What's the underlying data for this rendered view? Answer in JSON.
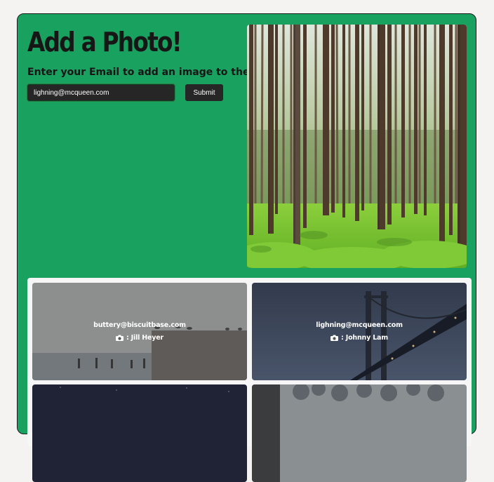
{
  "header": {
    "title": "Add a Photo!",
    "subtitle": "Enter your Email to add an image to the list"
  },
  "form": {
    "email_value": "lighning@mcqueen.com",
    "submit_label": "Submit"
  },
  "gallery": {
    "tiles": [
      {
        "email": "buttery@biscuitbase.com",
        "credit": ": Jill Heyer"
      },
      {
        "email": "lighning@mcqueen.com",
        "credit": ": Johnny Lam"
      },
      {
        "email": "",
        "credit": ""
      },
      {
        "email": "",
        "credit": ""
      }
    ]
  },
  "colors": {
    "background": "#f4f3f2",
    "card": "#19a15f",
    "dark": "#262626"
  },
  "icons": {
    "subtitle_icon": "smiley-icon",
    "credit_icon": "camera-icon"
  }
}
